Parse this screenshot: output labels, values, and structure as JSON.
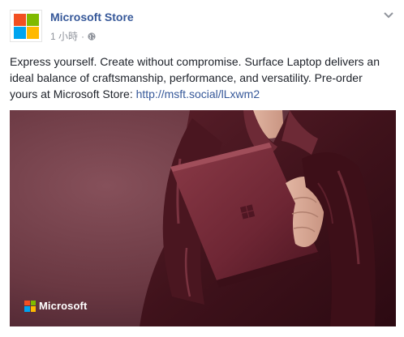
{
  "post": {
    "page_name": "Microsoft Store",
    "timestamp": "1 小時",
    "separator": "·",
    "privacy_icon": "globe-icon",
    "options_icon": "chevron-down-icon",
    "body_text": "Express yourself. Create without compromise. Surface Laptop delivers an ideal balance of craftsmanship, performance, and versatility. Pre-order yours at Microsoft Store: ",
    "link_text": "http://msft.social/lLxwm2"
  },
  "image": {
    "watermark_text": "Microsoft",
    "alt": "Person in burgundy leather jacket holding a burgundy Surface Laptop"
  },
  "colors": {
    "ms_red": "#f25022",
    "ms_green": "#7fba00",
    "ms_blue": "#00a4ef",
    "ms_yellow": "#ffb900",
    "link": "#365899",
    "meta": "#90949c",
    "background_mauve": "#6b3a43"
  }
}
